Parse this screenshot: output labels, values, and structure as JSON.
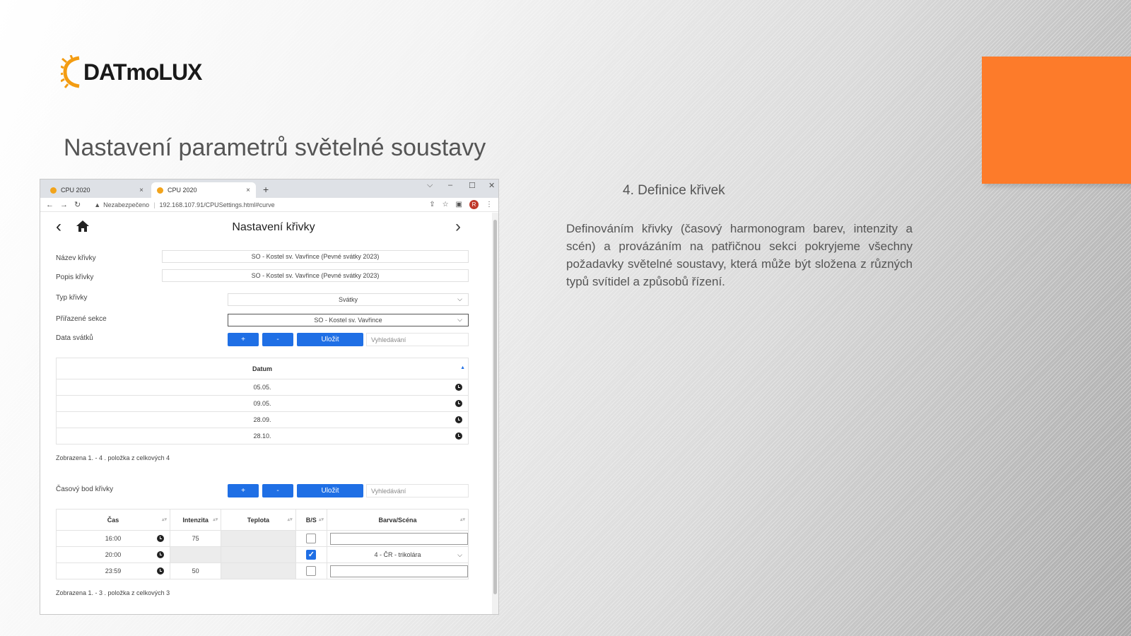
{
  "logo": {
    "text": "DATmoLUX"
  },
  "slide": {
    "title": "Nastavení parametrů světelné soustavy",
    "section_title": "4. Definice křivek",
    "section_text": "Definováním křivky (časový harmonogram barev, intenzity a scén) a provázáním na patřičnou sekci pokryjeme všechny požadavky světelné soustavy, která může být složena z různých typů svítidel a způsobů řízení."
  },
  "colors": {
    "accent_orange": "#fd7b2a",
    "button_blue": "#1f6fe5"
  },
  "browser": {
    "tabs": [
      {
        "label": "CPU 2020",
        "close": "×"
      },
      {
        "label": "CPU 2020",
        "close": "×"
      }
    ],
    "new_tab": "+",
    "security": "Nezabezpečeno",
    "url": "192.168.107.91/CPUSettings.html#curve",
    "profile_initial": "R"
  },
  "page": {
    "title": "Nastavení křivky",
    "form": {
      "name_label": "Název křivky",
      "name_value": "SO - Kostel sv. Vavřince (Pevné svátky 2023)",
      "desc_label": "Popis křivky",
      "desc_value": "SO - Kostel sv. Vavřince (Pevné svátky 2023)",
      "type_label": "Typ křivky",
      "type_value": "Svátky",
      "sections_label": "Přiřazené sekce",
      "sections_value": "SO - Kostel sv. Vavřince",
      "holidays_label": "Data svátků"
    },
    "toolbar1": {
      "add": "+",
      "remove": "-",
      "save": "Uložit",
      "search_placeholder": "Vyhledávání"
    },
    "dates_table": {
      "header": "Datum",
      "rows": [
        "05.05.",
        "09.05.",
        "28.09.",
        "28.10."
      ],
      "footer": "Zobrazena 1. - 4 . položka z celkových 4"
    },
    "timepoint_label": "Časový bod křivky",
    "toolbar2": {
      "add": "+",
      "remove": "-",
      "save": "Uložit",
      "search_placeholder": "Vyhledávání"
    },
    "points_table": {
      "headers": [
        "Čas",
        "Intenzita",
        "Teplota",
        "B/S",
        "Barva/Scéna"
      ],
      "rows": [
        {
          "time": "16:00",
          "intensity": "75",
          "temp": "",
          "bs": false,
          "scene": ""
        },
        {
          "time": "20:00",
          "intensity": "",
          "temp": "",
          "bs": true,
          "scene": "4 - ČR - trikolára"
        },
        {
          "time": "23:59",
          "intensity": "50",
          "temp": "",
          "bs": false,
          "scene": ""
        }
      ],
      "footer": "Zobrazena 1. - 3 . položka z celkových 3"
    }
  }
}
